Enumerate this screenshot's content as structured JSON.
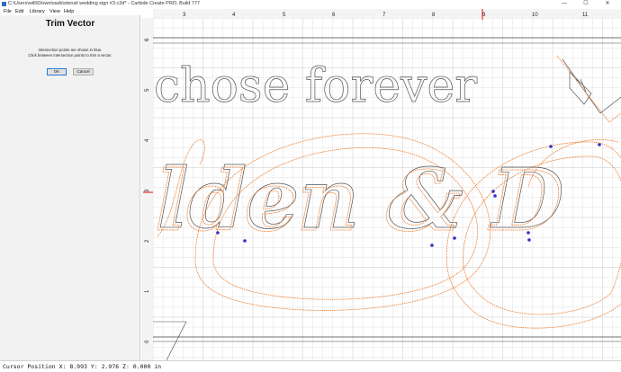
{
  "window": {
    "title": "C:\\Users\\willi\\Downloads\\stensil wedding sign #3.c2d* - Carbide Create PRO, Build 777",
    "controls": [
      "—",
      "☐",
      "✕"
    ]
  },
  "menu": [
    "File",
    "Edit",
    "Library",
    "View",
    "Help"
  ],
  "panel": {
    "title": "Trim Vector",
    "line1": "Intersection points are shown in blue.",
    "line2": "Click between intersection points to trim a vector.",
    "ok_label": "OK",
    "cancel_label": "Cancel"
  },
  "ruler": {
    "x_labels": [
      "3",
      "4",
      "5",
      "6",
      "7",
      "8",
      "9",
      "10",
      "11"
    ],
    "y_labels": [
      "6",
      "5",
      "4",
      "3",
      "2",
      "1",
      "0"
    ]
  },
  "design": {
    "text_top": "chose forever",
    "text_main": "lden & D"
  },
  "status": {
    "text": "Cursor Position X: 8.993 Y: 2.976 Z: 0.000 in"
  },
  "colors": {
    "vector_selected": "#ee7d2e",
    "vector_normal": "#555555",
    "grid": "#e2e2e2",
    "grid_major": "#c8c8c8",
    "intersection": "#3a2ccc",
    "cursor_marker": "#e53030"
  }
}
